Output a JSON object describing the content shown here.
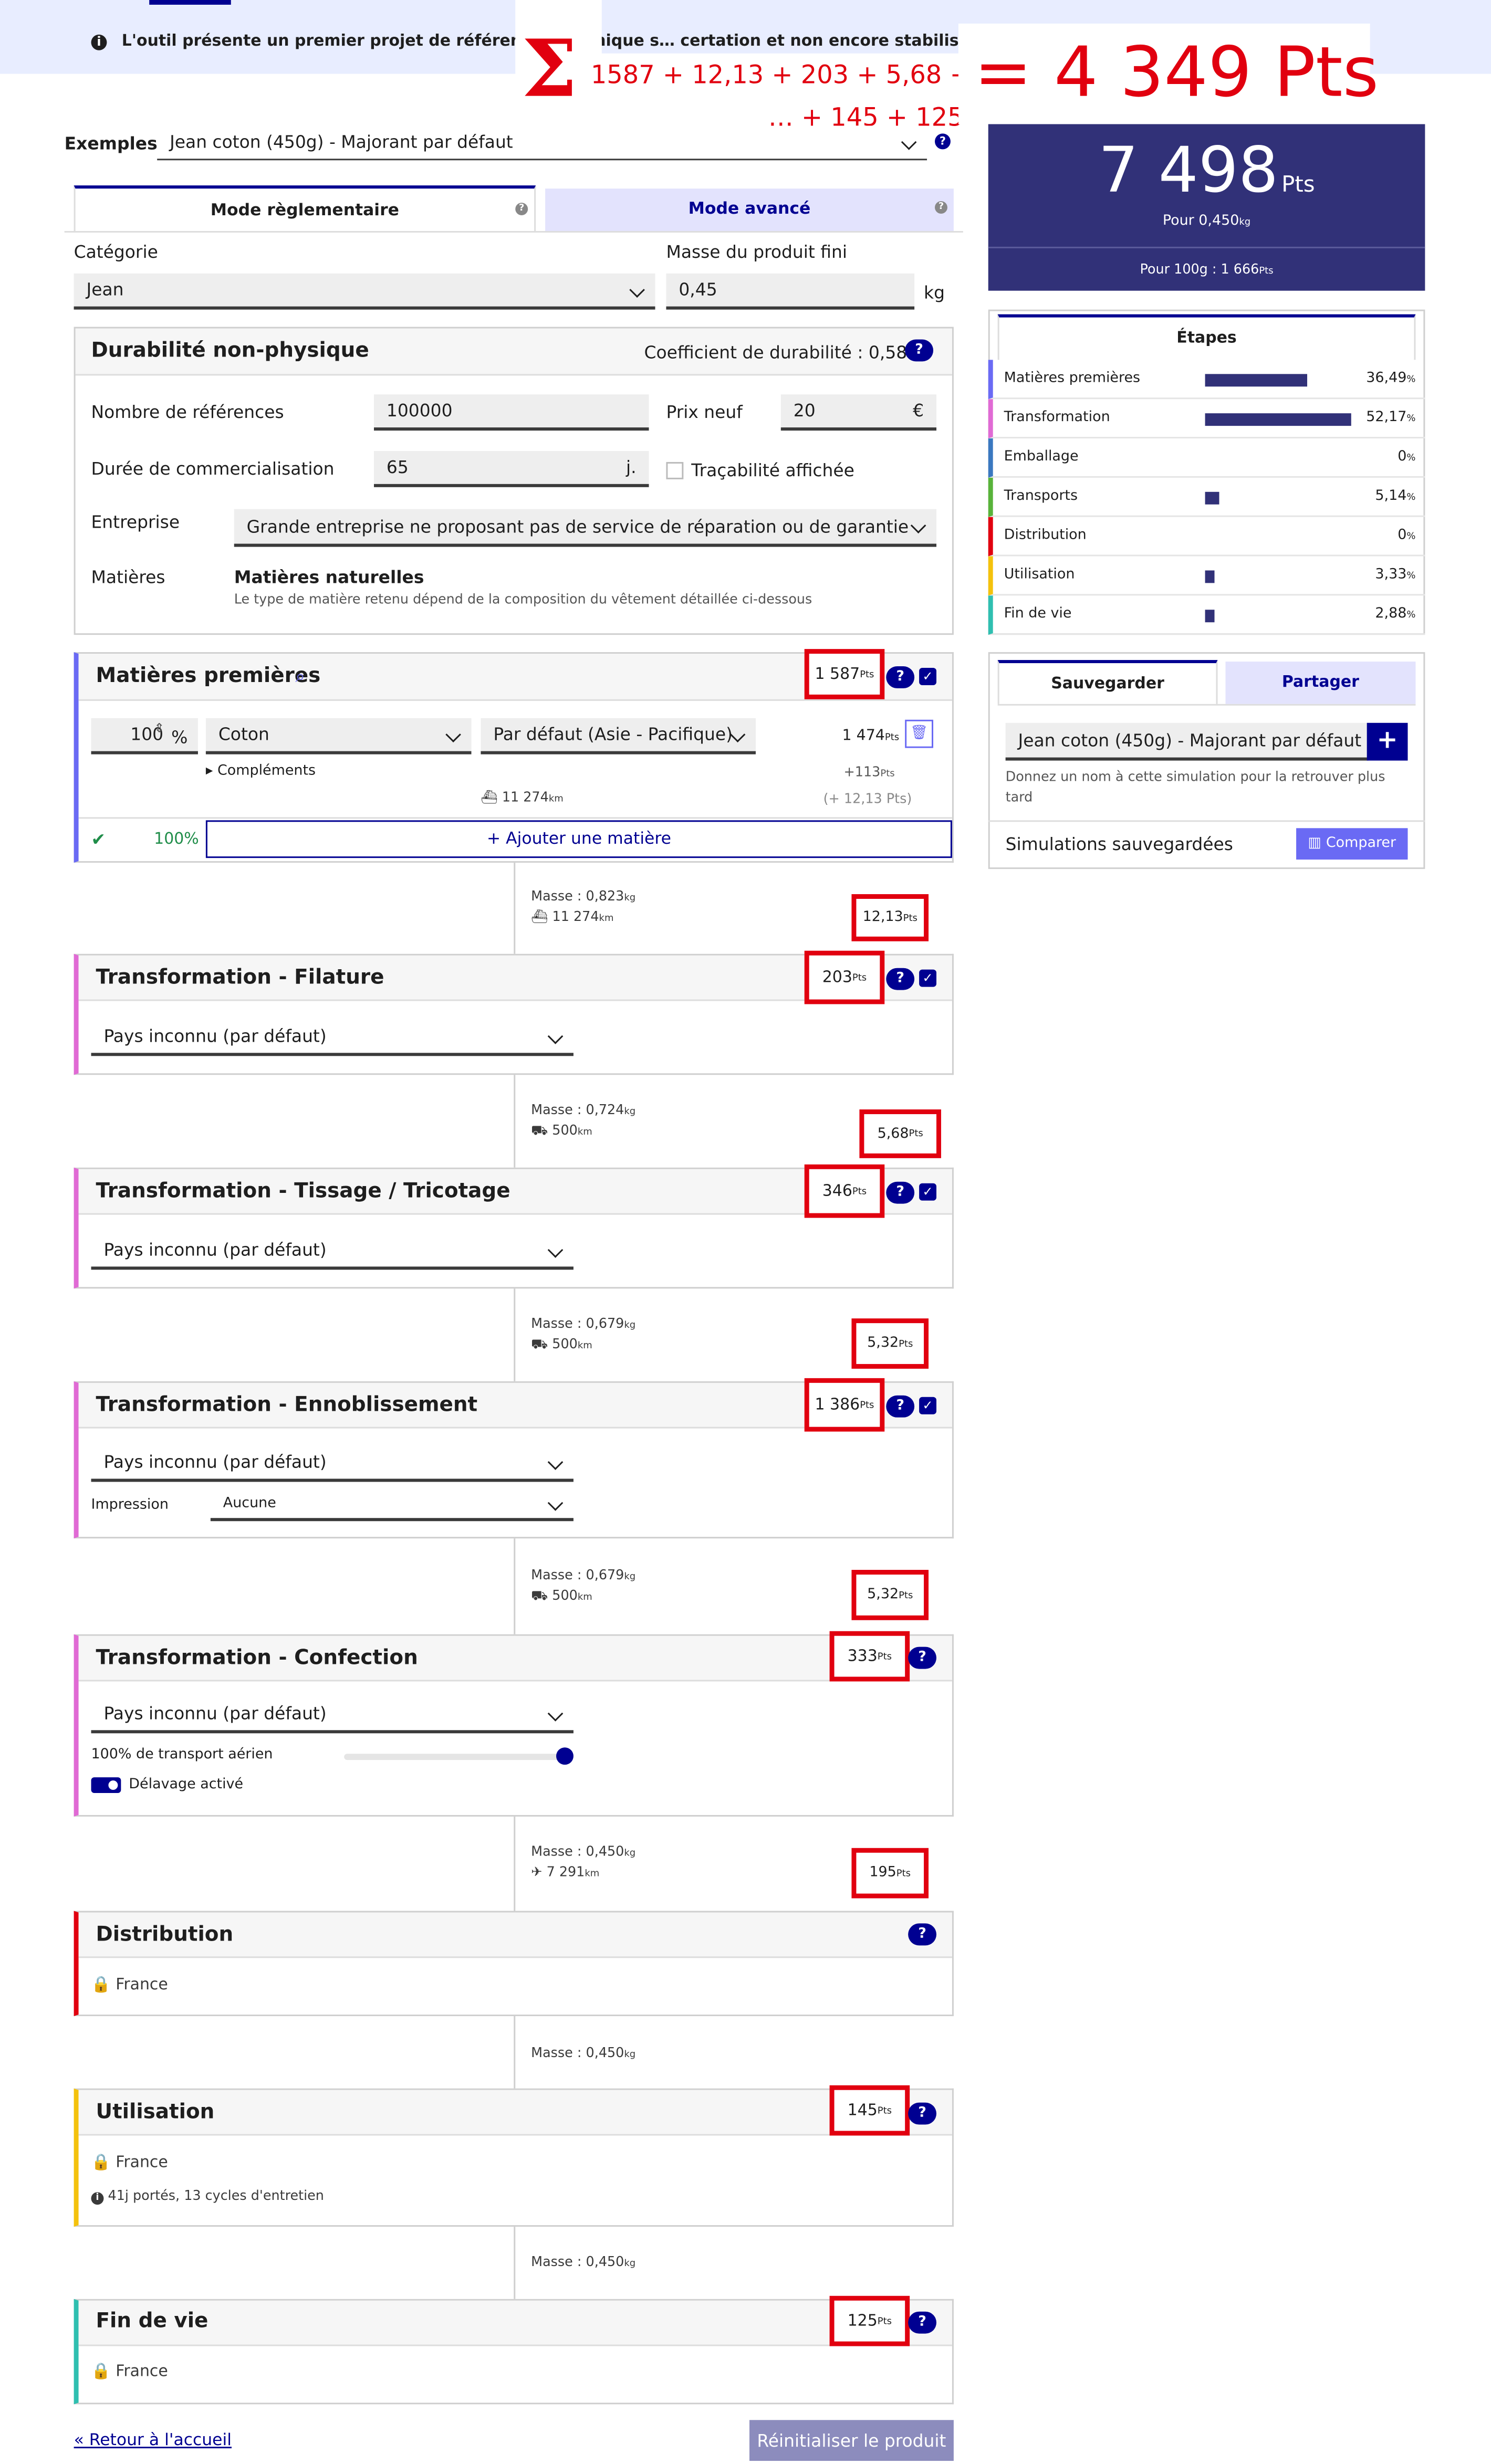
{
  "banner": {
    "text": "L'outil présente un premier projet de référentiel technique s… certation et non encore stabilisé"
  },
  "overlay": {
    "sum_line1": "1587 + 12,13 + 203 + 5,68 + …",
    "sum_line2": "… + 145 + 125",
    "result": "= 4 349 Pts",
    "sigma": "Σ"
  },
  "examples": {
    "label": "Exemples",
    "value": "Jean coton (450g) - Majorant par défaut"
  },
  "tabs": {
    "regulatory": "Mode règlementaire",
    "advanced": "Mode avancé"
  },
  "product": {
    "category_label": "Catégorie",
    "category_value": "Jean",
    "mass_label": "Masse du produit fini",
    "mass_value": "0,45",
    "mass_unit": "kg"
  },
  "durability": {
    "title": "Durabilité non-physique",
    "coef_label": "Coefficient de durabilité : 0,58",
    "refs_label": "Nombre de références",
    "refs_value": "100000",
    "price_label": "Prix neuf",
    "price_value": "20",
    "price_unit": "€",
    "duration_label": "Durée de commercialisation",
    "duration_value": "65",
    "duration_unit": "j.",
    "traceability_label": "Traçabilité affichée",
    "company_label": "Entreprise",
    "company_value": "Grande entreprise ne proposant pas de service de réparation ou de garantie",
    "materials_label": "Matières",
    "materials_title": "Matières naturelles",
    "materials_desc": "Le type de matière retenu dépend de la composition du vêtement détaillée ci-dessous"
  },
  "raw": {
    "title": "Matières premières",
    "pts": "1 587",
    "pts_unit": "Pts",
    "share": "100",
    "share_unit": "%",
    "material": "Coton",
    "origin": "Par défaut (Asie - Pacifique)",
    "material_pts": "1 474",
    "complements": "▸ Compléments",
    "complements_pts": "+113",
    "distance": "11 274",
    "distance_unit": "km",
    "transport_pts": "(+ 12,13 Pts)",
    "total": "100%",
    "add": "+ Ajouter une matière"
  },
  "transports": [
    {
      "mass": "Masse : 0,823",
      "dist": "11 274",
      "pts": "12,13"
    },
    {
      "mass": "Masse : 0,724",
      "dist": "500",
      "pts": "5,68"
    },
    {
      "mass": "Masse : 0,679",
      "dist": "500",
      "pts": "5,32"
    },
    {
      "mass": "Masse : 0,679",
      "dist": "500",
      "pts": "5,32"
    },
    {
      "mass": "Masse : 0,450",
      "dist": "7 291",
      "pts": "195"
    },
    {
      "mass": "Masse : 0,450"
    },
    {
      "mass": "Masse : 0,450"
    }
  ],
  "units": {
    "kg": "kg",
    "km": "km",
    "pts": "Pts"
  },
  "stages": {
    "spinning": {
      "title": "Transformation - Filature",
      "pts": "203",
      "country": "Pays inconnu (par défaut)"
    },
    "weaving": {
      "title": "Transformation - Tissage / Tricotage",
      "pts": "346",
      "country": "Pays inconnu (par défaut)"
    },
    "finishing": {
      "title": "Transformation - Ennoblissement",
      "pts": "1 386",
      "country": "Pays inconnu (par défaut)",
      "print_label": "Impression",
      "print_value": "Aucune"
    },
    "making": {
      "title": "Transformation - Confection",
      "pts": "333",
      "country": "Pays inconnu (par défaut)",
      "air_label": "100% de transport aérien",
      "delav_label": "Délavage activé"
    },
    "distribution": {
      "title": "Distribution",
      "country": "France"
    },
    "use": {
      "title": "Utilisation",
      "pts": "145",
      "country": "France",
      "info": "41j portés, 13 cycles d'entretien"
    },
    "eol": {
      "title": "Fin de vie",
      "pts": "125",
      "country": "France"
    }
  },
  "footer": {
    "back": "« Retour à l'accueil",
    "reset": "Réinitialiser le produit"
  },
  "score": {
    "value": "7 498",
    "unit": "Pts",
    "per": "Pour 0,450",
    "per_unit": "kg",
    "per100": "Pour 100g : 1 666",
    "per100_unit": "Pts"
  },
  "steps": {
    "title": "Étapes",
    "rows": [
      {
        "label": "Matières premières",
        "pct": "36,49",
        "value": 36.49,
        "color": "#6a6af4"
      },
      {
        "label": "Transformation",
        "pct": "52,17",
        "value": 52.17,
        "color": "#e06ad4"
      },
      {
        "label": "Emballage",
        "pct": "0",
        "value": 0,
        "color": "#3a78c0"
      },
      {
        "label": "Transports",
        "pct": "5,14",
        "value": 5.14,
        "color": "#58b33a"
      },
      {
        "label": "Distribution",
        "pct": "0",
        "value": 0,
        "color": "#e1000f"
      },
      {
        "label": "Utilisation",
        "pct": "3,33",
        "value": 3.33,
        "color": "#f4c20d"
      },
      {
        "label": "Fin de vie",
        "pct": "2,88",
        "value": 2.88,
        "color": "#2fbfb0"
      }
    ]
  },
  "save": {
    "tab_save": "Sauvegarder",
    "tab_share": "Partager",
    "name_value": "Jean coton (450g) - Majorant par défaut",
    "hint": "Donnez un nom à cette simulation pour la retrouver plus tard",
    "saved_label": "Simulations sauvegardées",
    "compare": "Comparer"
  },
  "colors": {
    "accent": "#000091",
    "score_bg": "#313178",
    "highlight": "#e1000f"
  }
}
